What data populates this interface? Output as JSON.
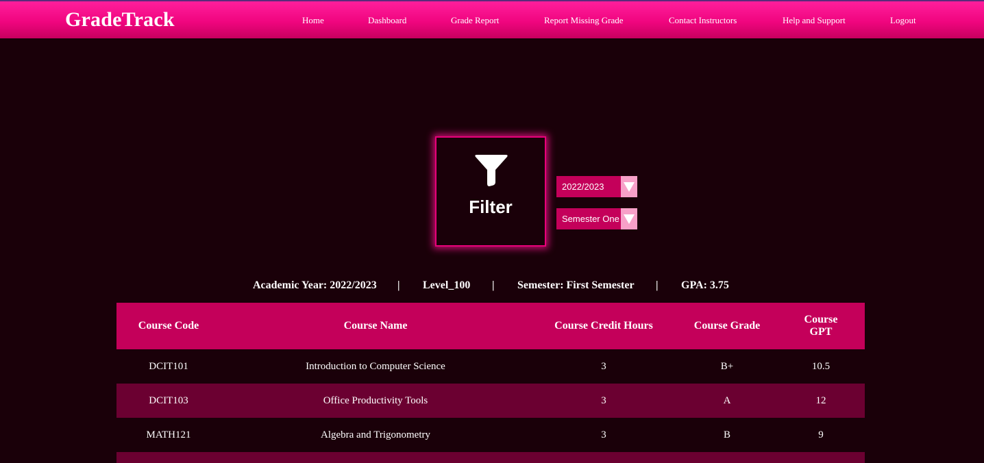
{
  "header": {
    "logo": "GradeTrack",
    "nav": [
      "Home",
      "Dashboard",
      "Grade Report",
      "Report Missing Grade",
      "Contact Instructors",
      "Help and Support",
      "Logout"
    ]
  },
  "filter": {
    "label": "Filter",
    "icon": "filter-funnel-icon",
    "year_value": "2022/2023",
    "semester_value": "Semester One"
  },
  "summary": {
    "academic_year": "Academic Year: 2022/2023",
    "level": "Level_100",
    "semester": "Semester: First Semester",
    "gpa": "GPA: 3.75",
    "separator": "|"
  },
  "table": {
    "headers": [
      "Course Code",
      "Course Name",
      "Course Credit Hours",
      "Course Grade",
      "Course GPT"
    ],
    "rows": [
      [
        "DCIT101",
        "Introduction to Computer Science",
        "3",
        "B+",
        "10.5"
      ],
      [
        "DCIT103",
        "Office Productivity Tools",
        "3",
        "A",
        "12"
      ],
      [
        "MATH121",
        "Algebra and Trigonometry",
        "3",
        "B",
        "9"
      ]
    ]
  },
  "colors": {
    "accent": "#f0057f",
    "table_header": "#c4005a",
    "row_alt": "#6b0031",
    "background": "#1a0009"
  }
}
